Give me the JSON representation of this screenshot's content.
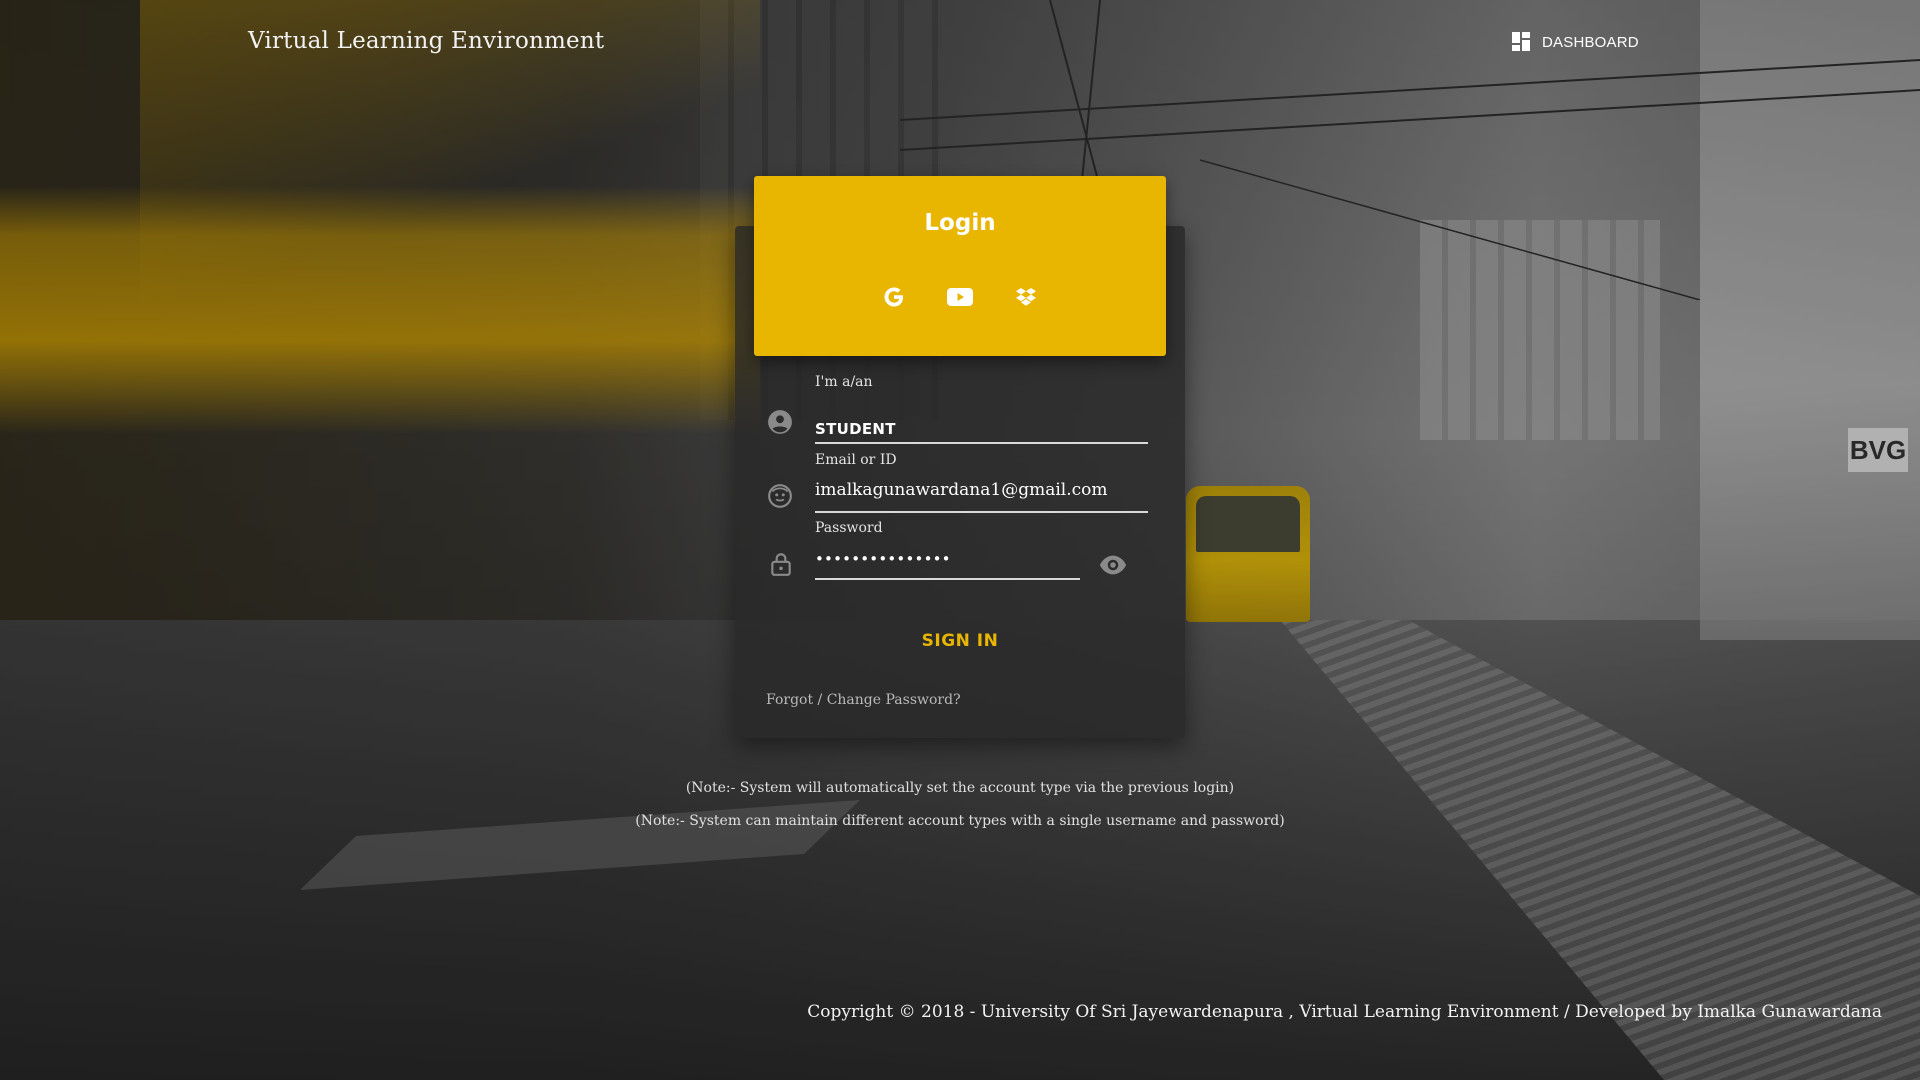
{
  "header": {
    "brand": "Virtual Learning Environment",
    "dashboard_label": "DASHBOARD",
    "dashboard_icon": "dashboard-icon"
  },
  "login": {
    "title": "Login",
    "social": [
      {
        "icon": "google-icon",
        "label": "Google"
      },
      {
        "icon": "youtube-icon",
        "label": "YouTube"
      },
      {
        "icon": "dropbox-icon",
        "label": "Dropbox"
      }
    ],
    "role": {
      "label": "I'm a/an",
      "value": "STUDENT",
      "icon": "account-circle-icon"
    },
    "email": {
      "label": "Email or ID",
      "value": "imalkagunawardana1@gmail.com",
      "icon": "face-icon"
    },
    "password": {
      "label": "Password",
      "value": "•••••••••••••••",
      "icon": "lock-icon",
      "toggle_icon": "eye-icon"
    },
    "signin_label": "SIGN IN",
    "forgot_label": "Forgot / Change Password?"
  },
  "notes": [
    "(Note:- System will automatically set the account type via the previous login)",
    "(Note:- System can maintain different account types with a single username and password)"
  ],
  "footer": {
    "copyright": "Copyright © 2018 - University Of Sri Jayewardenapura , Virtual Learning Environment / Developed by Imalka Gunawardana"
  },
  "colors": {
    "accent": "#e8b500",
    "card_bg": "#282828"
  }
}
